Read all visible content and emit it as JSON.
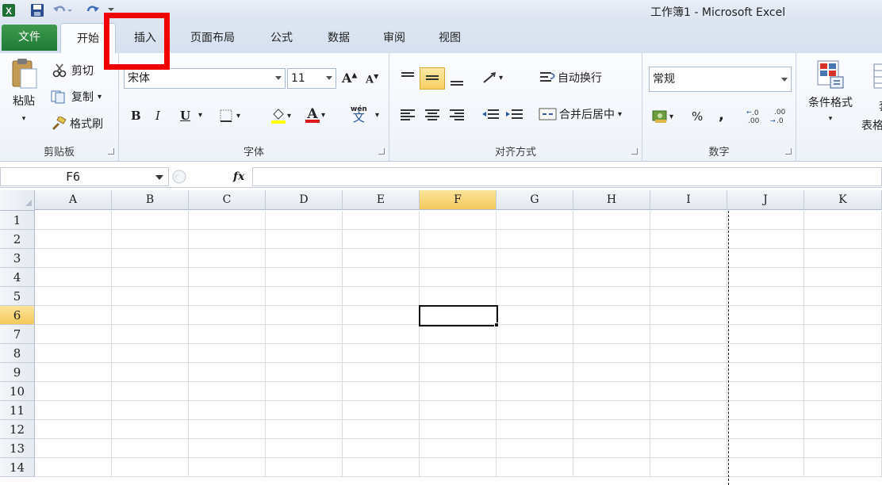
{
  "window": {
    "title": "工作簿1 - Microsoft Excel"
  },
  "tabs": [
    "文件",
    "开始",
    "插入",
    "页面布局",
    "公式",
    "数据",
    "审阅",
    "视图"
  ],
  "clipboard": {
    "paste": "粘贴",
    "cut": "剪切",
    "copy": "复制",
    "format_painter": "格式刷",
    "group_label": "剪贴板"
  },
  "font": {
    "name": "宋体",
    "size": "11",
    "bold": "B",
    "italic": "I",
    "underline": "U",
    "group_label": "字体",
    "phonetic": "wén"
  },
  "alignment": {
    "wrap_text": "自动换行",
    "merge_center": "合并后居中",
    "group_label": "对齐方式"
  },
  "number": {
    "format": "常规",
    "percent": "%",
    "comma": ",",
    "group_label": "数字"
  },
  "styles": {
    "conditional_format": "条件格式",
    "table_partial": "表格",
    "partial_char": "套"
  },
  "namebox": {
    "value": "F6"
  },
  "formula": {
    "fx": "fx",
    "value": ""
  },
  "columns": [
    "A",
    "B",
    "C",
    "D",
    "E",
    "F",
    "G",
    "H",
    "I",
    "J",
    "K"
  ],
  "rows": [
    "1",
    "2",
    "3",
    "4",
    "5",
    "6",
    "7",
    "8",
    "9",
    "10",
    "11",
    "12",
    "13",
    "14"
  ],
  "selection": {
    "cell": "F6",
    "column": "F",
    "row": "6"
  },
  "colors": {
    "file_tab": "#2a8a3e",
    "highlight": "#f10000",
    "selected_header": "#f8d677"
  }
}
